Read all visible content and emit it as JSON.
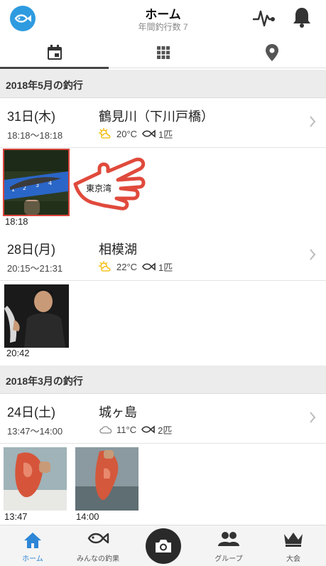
{
  "header": {
    "title": "ホーム",
    "subtitle": "年間釣行数 7"
  },
  "tabs": [
    {
      "name": "calendar",
      "icon": "calendar-icon",
      "active": true
    },
    {
      "name": "grid",
      "icon": "grid-icon",
      "active": false
    },
    {
      "name": "map",
      "icon": "map-pin-icon",
      "active": false
    }
  ],
  "sections": [
    {
      "title": "2018年5月の釣行",
      "trips": [
        {
          "date": "31日(木)",
          "time": "18:18〜18:18",
          "place": "鶴見川（下川戸橋）",
          "weather_icon": "partly-cloudy-icon",
          "temperature": "20°C",
          "catch_count": "1匹",
          "photos": [
            {
              "time": "18:18",
              "label": "東京湾",
              "highlighted": true
            }
          ]
        },
        {
          "date": "28日(月)",
          "time": "20:15〜21:31",
          "place": "相模湖",
          "weather_icon": "partly-cloudy-icon",
          "temperature": "22°C",
          "catch_count": "1匹",
          "photos": [
            {
              "time": "20:42"
            }
          ]
        }
      ]
    },
    {
      "title": "2018年3月の釣行",
      "trips": [
        {
          "date": "24日(土)",
          "time": "13:47〜14:00",
          "place": "城ヶ島",
          "weather_icon": "cloudy-icon",
          "temperature": "11°C",
          "catch_count": "2匹",
          "photos": [
            {
              "time": "13:47"
            },
            {
              "time": "14:00"
            }
          ]
        }
      ]
    }
  ],
  "bottom_nav": [
    {
      "label": "ホーム",
      "icon": "home-icon",
      "active": true
    },
    {
      "label": "みんなの釣果",
      "icon": "fish-icon",
      "active": false
    },
    {
      "label": "",
      "icon": "camera-icon",
      "active": false
    },
    {
      "label": "グループ",
      "icon": "group-icon",
      "active": false
    },
    {
      "label": "大会",
      "icon": "crown-icon",
      "active": false
    }
  ],
  "colors": {
    "accent": "#2e9be0",
    "active_nav": "#2e86d6",
    "section_bg": "#ececec",
    "highlight_border": "#d9443a",
    "weather_yellow": "#f2b900"
  }
}
